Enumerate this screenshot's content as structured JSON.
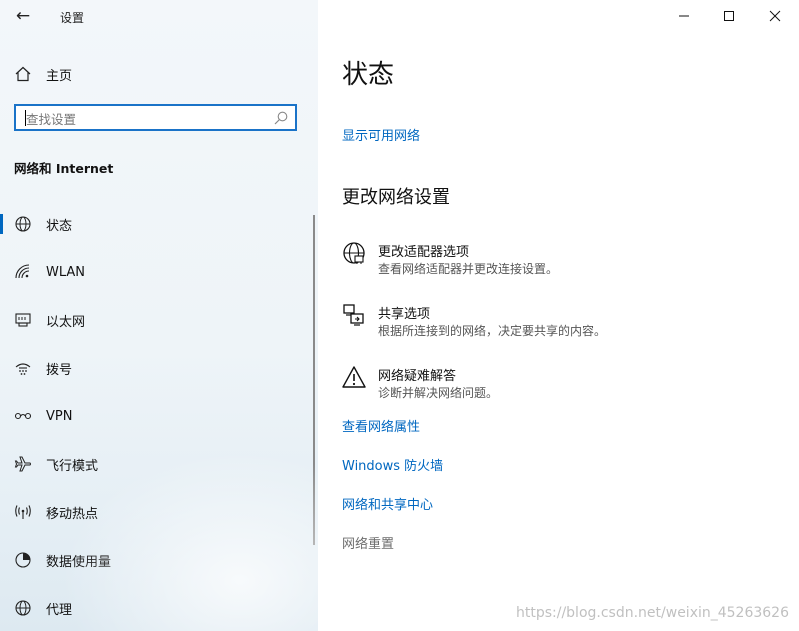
{
  "window": {
    "title": "设置"
  },
  "sidebar": {
    "home_label": "主页",
    "search_placeholder": "查找设置",
    "section_title": "网络和 Internet",
    "items": [
      {
        "label": "状态",
        "icon": "globe-icon",
        "selected": true
      },
      {
        "label": "WLAN",
        "icon": "wifi-icon",
        "selected": false
      },
      {
        "label": "以太网",
        "icon": "ethernet-icon",
        "selected": false
      },
      {
        "label": "拨号",
        "icon": "dialup-icon",
        "selected": false
      },
      {
        "label": "VPN",
        "icon": "vpn-icon",
        "selected": false
      },
      {
        "label": "飞行模式",
        "icon": "airplane-icon",
        "selected": false
      },
      {
        "label": "移动热点",
        "icon": "hotspot-icon",
        "selected": false
      },
      {
        "label": "数据使用量",
        "icon": "data-usage-icon",
        "selected": false
      },
      {
        "label": "代理",
        "icon": "proxy-globe-icon",
        "selected": false
      }
    ]
  },
  "main": {
    "title": "状态",
    "show_networks_link": "显示可用网络",
    "change_settings_heading": "更改网络设置",
    "options": [
      {
        "title": "更改适配器选项",
        "desc": "查看网络适配器并更改连接设置。",
        "icon": "adapter-globe-icon"
      },
      {
        "title": "共享选项",
        "desc": "根据所连接到的网络，决定要共享的内容。",
        "icon": "sharing-icon"
      },
      {
        "title": "网络疑难解答",
        "desc": "诊断并解决网络问题。",
        "icon": "warning-icon"
      }
    ],
    "links": [
      "查看网络属性",
      "Windows 防火墙",
      "网络和共享中心"
    ],
    "reset_link": "网络重置"
  },
  "watermark": "https://blog.csdn.net/weixin_45263626",
  "colors": {
    "accent": "#0067c0",
    "search_border": "#1a73c8"
  }
}
